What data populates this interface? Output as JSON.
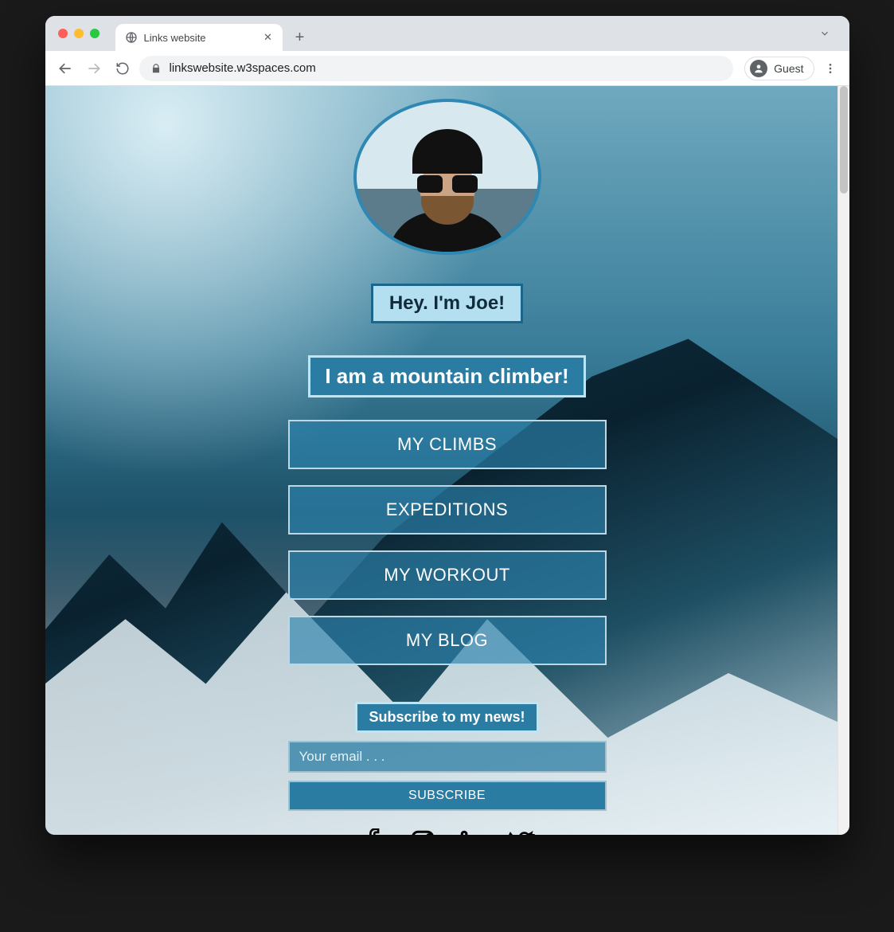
{
  "browser": {
    "tab_title": "Links website",
    "url": "linkswebsite.w3spaces.com",
    "guest_label": "Guest"
  },
  "page": {
    "greeting": "Hey. I'm Joe!",
    "tagline": "I am a mountain climber!",
    "links": [
      {
        "label": "MY CLIMBS"
      },
      {
        "label": "EXPEDITIONS"
      },
      {
        "label": "MY WORKOUT"
      },
      {
        "label": "MY BLOG"
      }
    ],
    "subscribe_heading": "Subscribe to my news!",
    "email_placeholder": "Your email . . .",
    "subscribe_button": "SUBSCRIBE",
    "socials": [
      "facebook-icon",
      "instagram-icon",
      "linkedin-icon",
      "twitter-icon"
    ]
  }
}
